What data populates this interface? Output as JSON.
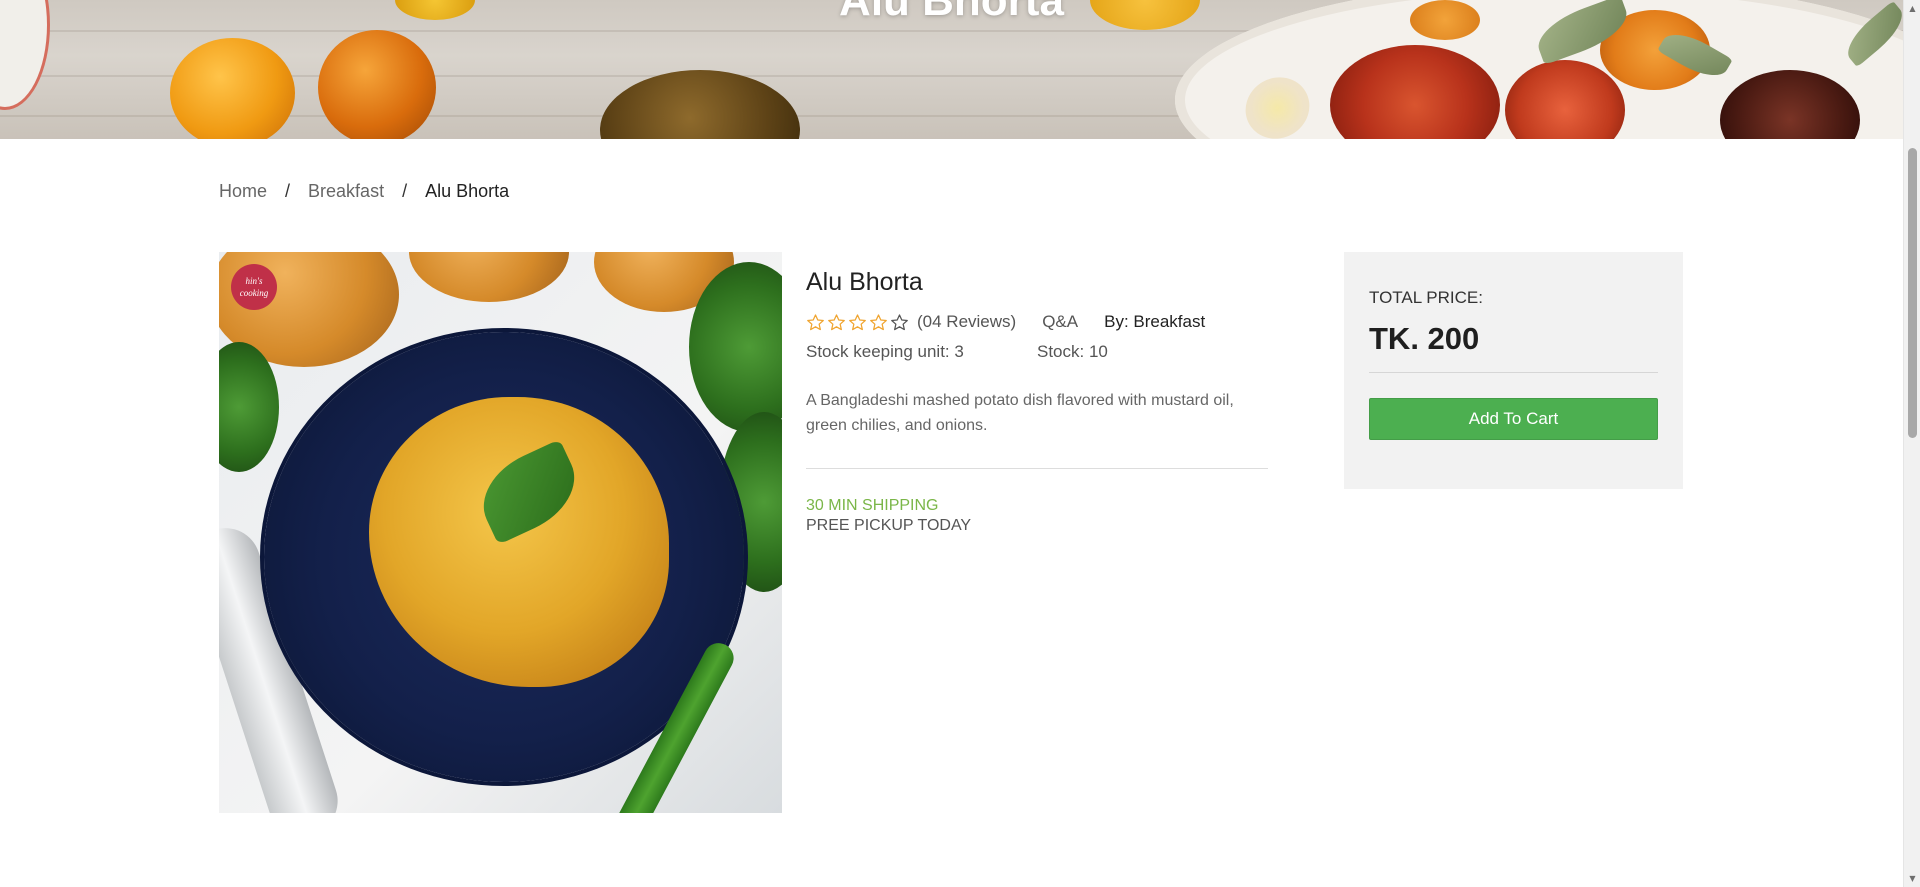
{
  "hero": {
    "title": "Alu Bhorta"
  },
  "breadcrumb": {
    "items": [
      "Home",
      "Breakfast"
    ],
    "separator": "/",
    "current": "Alu Bhorta"
  },
  "product": {
    "image_badge": "hin's cooking",
    "name": "Alu Bhorta",
    "rating": {
      "filled": 0,
      "max": 5
    },
    "reviews": "(04 Reviews)",
    "qa": "Q&A",
    "by": "By: Breakfast",
    "sku": "Stock keeping unit: 3",
    "stock": "Stock: 10",
    "description": "A Bangladeshi mashed potato dish flavored with mustard oil, green chilies, and onions.",
    "shipping": "30 MIN SHIPPING",
    "pickup": "PREE PICKUP TODAY"
  },
  "price_card": {
    "label": "TOTAL PRICE:",
    "amount": "TK. 200",
    "button": "Add To Cart"
  },
  "colors": {
    "accent_green": "#4caf50",
    "shipping_green": "#7ab648",
    "star_orange": "#f0a531",
    "card_bg": "#f2f2f2"
  },
  "icons": {
    "star": "star-outline-icon",
    "scroll_up": "chevron-up-icon",
    "scroll_down": "chevron-down-icon"
  }
}
